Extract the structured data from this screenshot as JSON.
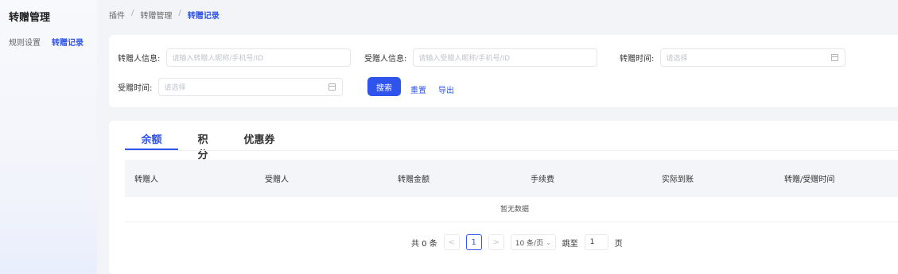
{
  "sidebar": {
    "title": "转赠管理",
    "items": [
      {
        "label": "规则设置"
      },
      {
        "label": "转赠记录"
      }
    ]
  },
  "breadcrumb": [
    "插件",
    "转赠管理",
    "转赠记录"
  ],
  "search": {
    "giver_label": "转赠人信息:",
    "giver_placeholder": "请输入转赠人昵称/手机号/ID",
    "receiver_label": "受赠人信息:",
    "receiver_placeholder": "请输入受赠人昵称/手机号/ID",
    "give_time_label": "转赠时间:",
    "give_time_placeholder": "请选择",
    "receive_time_label": "受赠时间:",
    "receive_time_placeholder": "请选择",
    "search_btn": "搜索",
    "reset_link": "重置",
    "export_link": "导出"
  },
  "tabs": [
    {
      "label": "余额"
    },
    {
      "label": "积分"
    },
    {
      "label": "优惠券"
    }
  ],
  "table": {
    "headers": [
      "转赠人",
      "受赠人",
      "转赠金额",
      "手续费",
      "实际到账",
      "转赠/受赠时间"
    ],
    "empty_text": "暂无数据"
  },
  "pagination": {
    "total": "共 0 条",
    "prev": "<",
    "current": "1",
    "next": ">",
    "page_size": "10 条/页",
    "jump_label": "跳至",
    "jump_value": "1",
    "page_suffix": "页"
  },
  "colors": {
    "accent": "#2f54eb"
  }
}
